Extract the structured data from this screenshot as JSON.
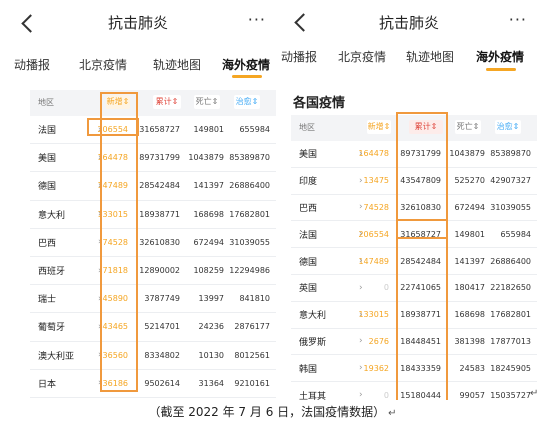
{
  "left": {
    "title": "抗击肺炎",
    "more": "···",
    "tabs": [
      "动播报",
      "北京疫情",
      "轨迹地图",
      "海外疫情"
    ],
    "columns": [
      "地区",
      "新增",
      "累计",
      "死亡",
      "治愈"
    ],
    "rows": [
      {
        "region": "法国",
        "new": "206554",
        "total": "31658727",
        "deaths": "149801",
        "cured": "655984"
      },
      {
        "region": "美国",
        "new": "164478",
        "total": "89731799",
        "deaths": "1043879",
        "cured": "85389870"
      },
      {
        "region": "德国",
        "new": "147489",
        "total": "28542484",
        "deaths": "141397",
        "cured": "26886400"
      },
      {
        "region": "意大利",
        "new": "133015",
        "total": "18938771",
        "deaths": "168698",
        "cured": "17682801"
      },
      {
        "region": "巴西",
        "new": "74528",
        "total": "32610830",
        "deaths": "672494",
        "cured": "31039055"
      },
      {
        "region": "西班牙",
        "new": "71818",
        "total": "12890002",
        "deaths": "108259",
        "cured": "12294986"
      },
      {
        "region": "瑞士",
        "new": "45890",
        "total": "3787749",
        "deaths": "13997",
        "cured": "841810"
      },
      {
        "region": "葡萄牙",
        "new": "43465",
        "total": "5214701",
        "deaths": "24236",
        "cured": "2876177"
      },
      {
        "region": "澳大利亚",
        "new": "36560",
        "total": "8334802",
        "deaths": "10130",
        "cured": "8012561"
      },
      {
        "region": "日本",
        "new": "36186",
        "total": "9502614",
        "deaths": "31364",
        "cured": "9210161"
      }
    ]
  },
  "right": {
    "title": "抗击肺炎",
    "more": "···",
    "tabs": [
      "动播报",
      "北京疫情",
      "轨迹地图",
      "海外疫情"
    ],
    "subtitle": "各国疫情",
    "columns": [
      "地区",
      "新增",
      "累计",
      "死亡",
      "治愈"
    ],
    "rows": [
      {
        "region": "美国",
        "new": "164478",
        "total": "89731799",
        "deaths": "1043879",
        "cured": "85389870"
      },
      {
        "region": "印度",
        "new": "13475",
        "total": "43547809",
        "deaths": "525270",
        "cured": "42907327"
      },
      {
        "region": "巴西",
        "new": "74528",
        "total": "32610830",
        "deaths": "672494",
        "cured": "31039055"
      },
      {
        "region": "法国",
        "new": "206554",
        "total": "31658727",
        "deaths": "149801",
        "cured": "655984"
      },
      {
        "region": "德国",
        "new": "147489",
        "total": "28542484",
        "deaths": "141397",
        "cured": "26886400"
      },
      {
        "region": "英国",
        "new": "0",
        "total": "22741065",
        "deaths": "180417",
        "cured": "22182650"
      },
      {
        "region": "意大利",
        "new": "133015",
        "total": "18938771",
        "deaths": "168698",
        "cured": "17682801"
      },
      {
        "region": "俄罗斯",
        "new": "2676",
        "total": "18448451",
        "deaths": "381398",
        "cured": "17877013"
      },
      {
        "region": "韩国",
        "new": "19362",
        "total": "18433359",
        "deaths": "24583",
        "cured": "18245905"
      },
      {
        "region": "土耳其",
        "new": "0",
        "total": "15180444",
        "deaths": "99057",
        "cured": "15035727"
      }
    ]
  },
  "caption": "（截至 2022 年 7 月 6 日，法国疫情数据）",
  "caption_mark": "↵",
  "side_mark": "↵",
  "colors": {
    "accent": "#f5a623",
    "highlight_box": "#f0993d",
    "total_header": "#e0483e",
    "cured_header": "#3fa9f5"
  }
}
